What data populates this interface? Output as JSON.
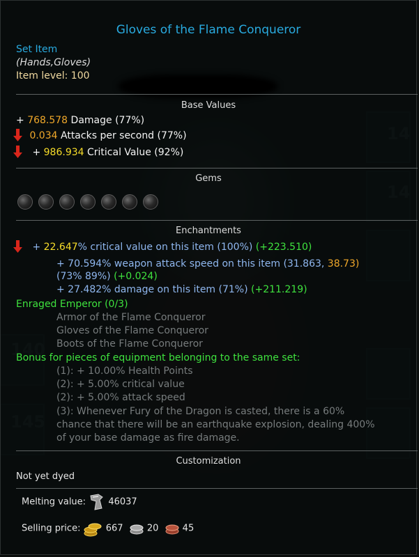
{
  "item": {
    "title": "Gloves of the Flame Conqueror",
    "type": "Set Item",
    "slot": "(Hands,Gloves)",
    "level_label": "Item level:",
    "level_value": "100"
  },
  "base": {
    "heading": "Base Values",
    "damage": {
      "prefix": "+",
      "value": "768.578",
      "label": "Damage (77%)"
    },
    "aps": {
      "value": "0.034",
      "label": "Attacks per second (77%)"
    },
    "crit": {
      "prefix": "+",
      "value": "986.934",
      "label": "Critical Value (92%)"
    }
  },
  "gems": {
    "heading": "Gems",
    "count": 7
  },
  "enchant": {
    "heading": "Enchantments",
    "e1": {
      "prefix": "+",
      "value": "22.647",
      "label": "% critical value on this item (100%)",
      "bonus": "(+223.510)"
    },
    "e2": {
      "text": "+ 70.594% weapon attack speed on this item (31.863,",
      "tail": "38.73)",
      "line2": "(73% 89%)",
      "bonus": "(+0.024)"
    },
    "e3": {
      "text": "+ 27.482% damage on this item (71%)",
      "bonus": "(+211.219)"
    }
  },
  "set": {
    "name": "Enraged Emperor (0/3)",
    "pieces": [
      "Armor of the Flame Conqueror",
      "Gloves of the Flame Conqueror",
      "Boots of the Flame Conqueror"
    ],
    "bonus_heading": "Bonus for pieces of equipment belonging to the same set:",
    "bonuses": [
      "(1): + 10.00% Health Points",
      "(2): + 5.00% critical value",
      "(2): + 5.00% attack speed"
    ],
    "bonus4": [
      "(3): Whenever Fury of the Dragon is casted, there is a 60%",
      "chance that there will be an earthquake explosion, dealing 400%",
      "of your base damage as fire damage."
    ]
  },
  "custom": {
    "heading": "Customization",
    "status": "Not yet dyed"
  },
  "melting": {
    "label": "Melting value:",
    "value": "46037"
  },
  "selling": {
    "label": "Selling price:",
    "gold": "667",
    "silver": "20",
    "copper": "45"
  },
  "colors": {
    "title": "#29aadf",
    "orange": "#f0a82a",
    "yellow": "#f7dd29",
    "blue": "#8fb7ef",
    "green": "#3fe23e",
    "grey": "#777c7d"
  },
  "icons": [
    "down-arrow-icon",
    "gem-socket-icon",
    "anvil-icon",
    "gold-coin-icon",
    "silver-coin-icon",
    "copper-coin-icon"
  ]
}
